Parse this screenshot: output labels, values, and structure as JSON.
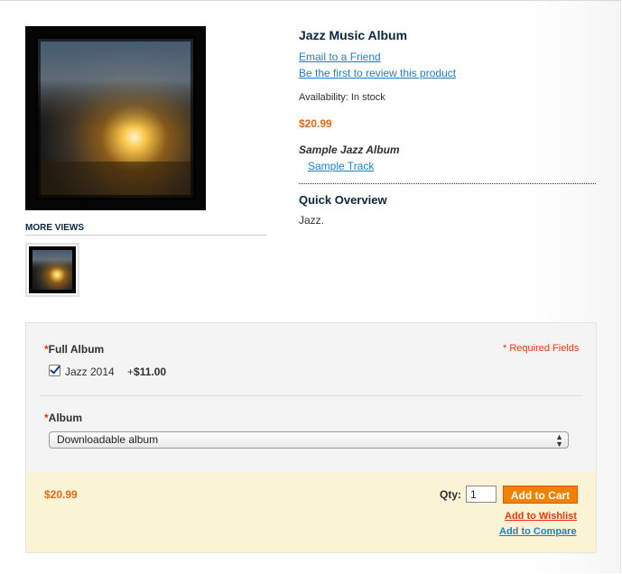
{
  "product": {
    "name": "Jazz Music Album",
    "email_link": "Email to a Friend",
    "review_link": "Be the first to review this product",
    "availability": "Availability: In stock",
    "price": "$20.99",
    "sample_title": "Sample Jazz Album",
    "sample_track": "Sample Track",
    "overview_title": "Quick Overview",
    "overview_text": "Jazz."
  },
  "media": {
    "more_views_title": "MORE VIEWS",
    "main_image_icon": "album-cover-image",
    "thumb_icon": "album-cover-thumbnail"
  },
  "options": {
    "required_star": "*",
    "full_album_label": "Full Album",
    "required_fields": "* Required Fields",
    "checkbox_checked": true,
    "jazz_label": "Jazz 2014",
    "jazz_price_prefix": "+",
    "jazz_price": "$11.00",
    "album_label": "Album",
    "album_selected": "Downloadable album"
  },
  "cart": {
    "price": "$20.99",
    "qty_label": "Qty:",
    "qty_value": "1",
    "add_to_cart": "Add to Cart",
    "add_to_wishlist": "Add to Wishlist",
    "add_to_compare": "Add to Compare"
  },
  "colors": {
    "price": "#df6614",
    "link": "#1e7ec8",
    "required": "#eb340a",
    "button": "#f18200",
    "cart_box_bg": "#fbf4d4",
    "options_box_bg": "#f4f4f4"
  }
}
